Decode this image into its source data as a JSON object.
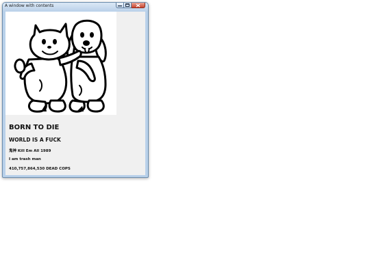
{
  "window": {
    "title": "A window with contents"
  },
  "content": {
    "heading": "BORN TO DIE",
    "subheading": "WORLD IS A FUCK",
    "line1": "鬼神 Kill Em All 1989",
    "line2": "I am trash man",
    "line3": "410,757,864,530 DEAD COPS"
  },
  "icons": {
    "minimize": "minimize-icon",
    "maximize": "maximize-icon",
    "close": "close-icon"
  },
  "colors": {
    "frame": "#b9d1ea",
    "close_button": "#c8442f",
    "client_background": "#f0f0f0"
  }
}
